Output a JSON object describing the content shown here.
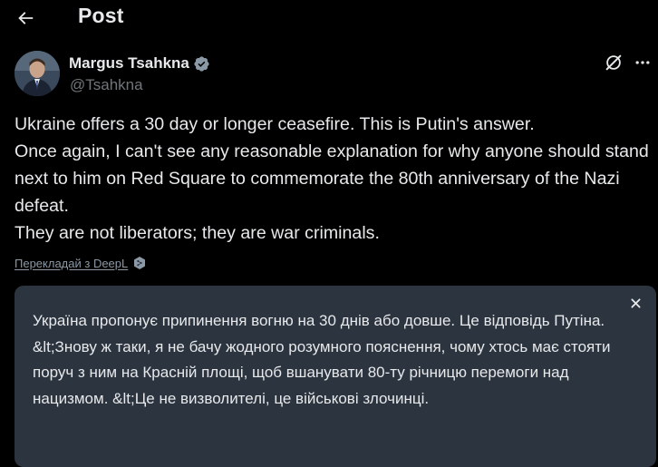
{
  "header": {
    "back_icon": "arrow-left-icon",
    "title": "Post"
  },
  "author": {
    "name": "Margus Tsahkna",
    "handle": "@Tsahkna",
    "verified_color": "#8b98a5",
    "icons": [
      "verified-badge-icon",
      "grok-icon",
      "more-icon"
    ]
  },
  "tweet": {
    "lines": [
      "Ukraine offers a 30 day or longer ceasefire. This is Putin's answer.",
      "Once again, I can't see any reasonable explanation for why anyone should stand next to him on Red Square to commemorate the 80th anniversary of the Nazi defeat.",
      "They are not liberators; they are war criminals."
    ]
  },
  "translate": {
    "link_label": "Перекладай з DeepL",
    "icon": "deepl-icon"
  },
  "translation": {
    "text": "Україна пропонує припинення вогню на 30 днів або довше. Це відповідь Путіна. &lt;Знову ж таки, я не бачу жодного розумного пояснення, чому хтось має стояти поруч з ним на Красній площі, щоб вшанувати 80-ту річницю перемоги над нацизмом. &lt;Це не визволителі, це військові злочинці.",
    "close_icon": "close-icon",
    "background": "#2c3440"
  },
  "colors": {
    "background": "#000000",
    "text": "#e7e9ea",
    "secondary": "#71767b"
  }
}
